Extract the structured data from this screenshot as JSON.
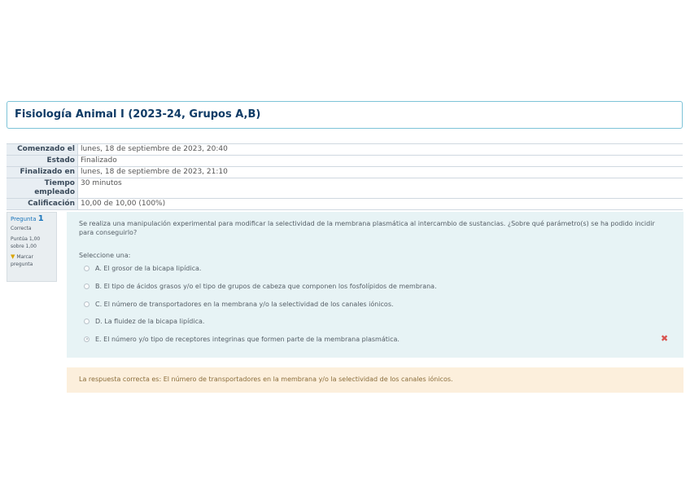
{
  "course": {
    "title": "Fisiología Animal I (2023-24, Grupos A,B)"
  },
  "summary": [
    {
      "label": "Comenzado el",
      "value": "lunes, 18 de septiembre de 2023, 20:40"
    },
    {
      "label": "Estado",
      "value": "Finalizado"
    },
    {
      "label": "Finalizado en",
      "value": "lunes, 18 de septiembre de 2023, 21:10"
    },
    {
      "label": "Tiempo empleado",
      "value": "30 minutos"
    },
    {
      "label": "Calificación",
      "value": "10,00 de 10,00 (100%)"
    }
  ],
  "question_info": {
    "label": "Pregunta",
    "number": "1",
    "state": "Correcta",
    "score": "Puntúa 1,00 sobre 1,00",
    "flag_label": "Marcar pregunta",
    "flag_icon": "flag-icon"
  },
  "question": {
    "text": "Se realiza una manipulación experimental para modificar la selectividad de la membrana plasmática al intercambio de sustancias. ¿Sobre qué parámetro(s) se ha podido incidir para conseguirlo?",
    "prompt": "Seleccione una:",
    "answers": [
      {
        "label": "A. El grosor de la bicapa lipídica.",
        "selected": false
      },
      {
        "label": "B. El tipo de ácidos grasos y/o el tipo de grupos de cabeza que componen los fosfolípidos de membrana.",
        "selected": false
      },
      {
        "label": "C. El número de transportadores en la membrana y/o la selectividad de los canales iónicos.",
        "selected": false
      },
      {
        "label": "D. La fluidez de la bicapa lipídica.",
        "selected": false
      },
      {
        "label": "E. El número y/o tipo de receptores integrinas que formen parte de la membrana plasmática.",
        "selected": true
      }
    ],
    "wrong_mark": "✖"
  },
  "feedback": {
    "text": "La respuesta correcta es: El número de transportadores en la membrana y/o la selectividad de los canales iónicos."
  },
  "colors": {
    "course_title": "#0f3b66",
    "question_bg": "#e7f3f5",
    "feedback_bg": "#fcefdc",
    "wrong": "#d9534f"
  }
}
